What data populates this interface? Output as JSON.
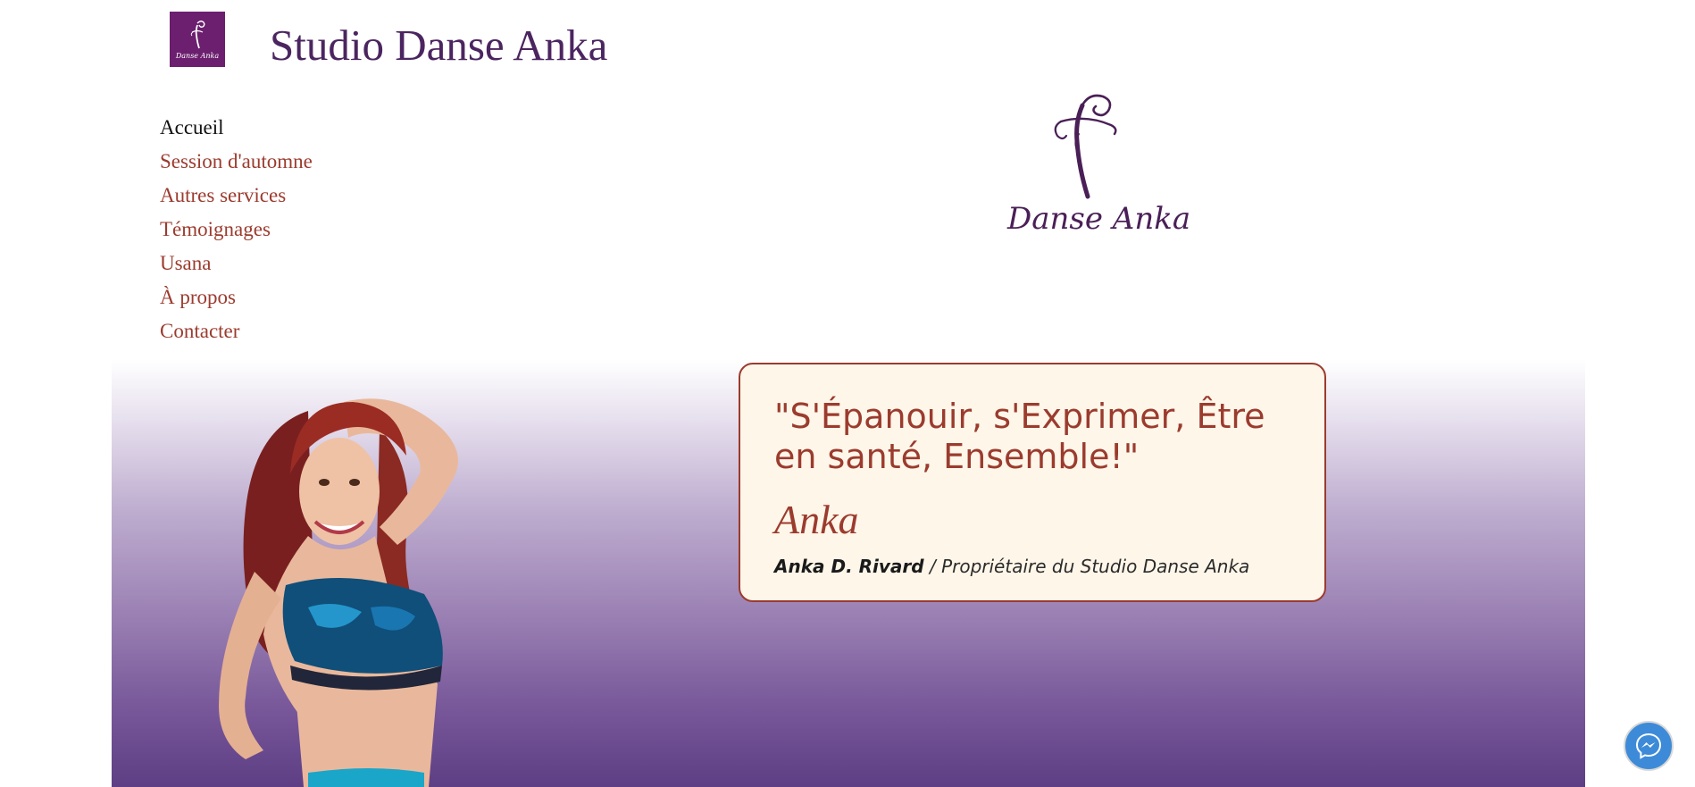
{
  "header": {
    "site_title": "Studio Danse Anka",
    "logo_small_text": "Danse Anka"
  },
  "nav": {
    "items": [
      {
        "label": "Accueil",
        "active": true
      },
      {
        "label": "Session d'automne",
        "active": false
      },
      {
        "label": "Autres services",
        "active": false
      },
      {
        "label": "Témoignages",
        "active": false
      },
      {
        "label": "Usana",
        "active": false
      },
      {
        "label": "À propos",
        "active": false
      },
      {
        "label": "Contacter",
        "active": false
      }
    ]
  },
  "brand_logo": {
    "text": "Danse Anka"
  },
  "quote": {
    "text": "\"S'Épanouir, s'Exprimer, Être en santé, Ensemble!\"",
    "signature": "Anka",
    "author_name": "Anka D. Rivard",
    "author_role": " / Propriétaire du Studio Danse Anka"
  },
  "colors": {
    "brand_purple": "#4b2560",
    "link_red": "#9b3b2e",
    "card_bg": "#fef6e9",
    "messenger_blue": "#3d8bd8"
  },
  "icons": {
    "messenger": "messenger-icon"
  }
}
